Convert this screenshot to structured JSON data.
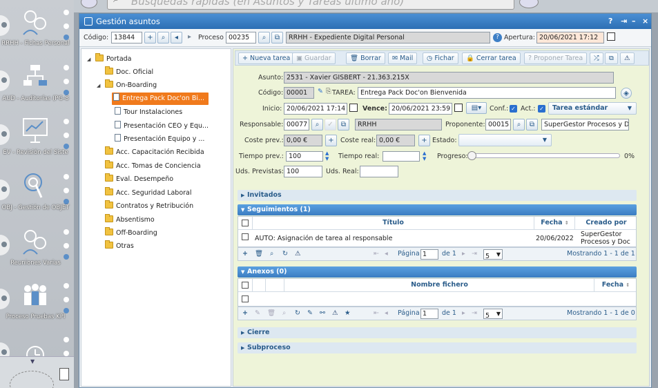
{
  "topbar": {
    "search_placeholder": "Búsquedas rápidas (en Asuntos y Tareas último año)"
  },
  "launcher": {
    "items": [
      {
        "label": "RRHH - Fichas Personal"
      },
      {
        "label": "AUD - Auditorías (PG-8"
      },
      {
        "label": "EV - Revisión del Siste"
      },
      {
        "label": "OBJ - Gestión de OBJET"
      },
      {
        "label": "Reuniones Varias"
      },
      {
        "label": "Proceso Pruebas KPI"
      }
    ]
  },
  "window": {
    "title": "Gestión asuntos",
    "controls": [
      "?",
      "⇥",
      "–",
      "×"
    ]
  },
  "header": {
    "codigo_label": "Código:",
    "codigo_value": "13844",
    "proceso_label": "Proceso",
    "proceso_value": "00235",
    "proceso_name": "RRHH - Expediente Digital Personal",
    "apertura_label": "Apertura:",
    "apertura_value": "20/06/2021 17:12"
  },
  "tree": {
    "items": [
      {
        "label": "Portada",
        "type": "folder"
      },
      {
        "label": "Doc. Oficial",
        "type": "folder"
      },
      {
        "label": "On-Boarding",
        "type": "folder"
      },
      {
        "label": "Entrega Pack Doc'on Bi...",
        "type": "page",
        "selected": true
      },
      {
        "label": "Tour Instalaciones",
        "type": "page"
      },
      {
        "label": "Presentación CEO y Equ...",
        "type": "page"
      },
      {
        "label": "Presentación Equipo y ...",
        "type": "page"
      },
      {
        "label": "Acc. Capacitación Recibida",
        "type": "folder"
      },
      {
        "label": "Acc. Tomas de Conciencia",
        "type": "folder"
      },
      {
        "label": "Eval. Desempeño",
        "type": "folder"
      },
      {
        "label": "Acc. Seguridad Laboral",
        "type": "folder"
      },
      {
        "label": "Contratos y Retribución",
        "type": "folder"
      },
      {
        "label": "Absentismo",
        "type": "folder"
      },
      {
        "label": "Off-Boarding",
        "type": "folder"
      },
      {
        "label": "Otras",
        "type": "folder"
      }
    ]
  },
  "toolbar": {
    "nueva": "Nueva tarea",
    "guardar": "Guardar",
    "borrar": "Borrar",
    "mail": "Mail",
    "fichar": "Fichar",
    "cerrar": "Cerrar tarea",
    "proponer": "Proponer Tarea"
  },
  "form": {
    "asunto_label": "Asunto:",
    "asunto_value": "2531 - Xavier GISBERT  - 21.363.215X",
    "codigo_label": "Código:",
    "codigo_value": "00001",
    "tarea_label": "TAREA:",
    "tarea_value": "Entrega Pack Doc'on Bienvenida",
    "inicio_label": "Inicio:",
    "inicio_value": "20/06/2021 17:14",
    "vence_label": "Vence:",
    "vence_value": "20/06/2021 23:59",
    "conf_label": "Conf.:",
    "act_label": "Act.:",
    "tipo_value": "Tarea estándar",
    "responsable_label": "Responsable:",
    "responsable_code": "00077",
    "responsable_name": "RRHH",
    "proponente_label": "Proponente:",
    "proponente_code": "00015",
    "proponente_name": "SuperGestor Procesos y Doc",
    "coste_prev_label": "Coste prev.:",
    "coste_prev_value": "0,00 €",
    "coste_real_label": "Coste real:",
    "coste_real_value": "0,00 €",
    "estado_label": "Estado:",
    "estado_value": "",
    "tiempo_prev_label": "Tiempo prev.:",
    "tiempo_prev_value": "100",
    "tiempo_real_label": "Tiempo real:",
    "tiempo_real_value": "",
    "progreso_label": "Progreso:",
    "progreso_value": "0%",
    "progreso_fraction": 0,
    "uds_prev_label": "Uds. Previstas:",
    "uds_prev_value": "100",
    "uds_real_label": "Uds. Real:",
    "uds_real_value": ""
  },
  "sections": {
    "invitados": "Invitados",
    "seguimientos": "Seguimientos (1)",
    "anexos": "Anexos (0)",
    "cierre": "Cierre",
    "subproceso": "Subproceso"
  },
  "seguimientos": {
    "columns": [
      "Título",
      "Fecha",
      "Creado por"
    ],
    "rows": [
      {
        "titulo": "AUTO: Asignación de tarea al responsable",
        "fecha": "20/06/2022",
        "creado_1": "SuperGestor",
        "creado_2": "Procesos y Doc"
      }
    ],
    "pager": {
      "pagina_label": "Página",
      "page": "1",
      "de_label": "de 1",
      "per_page": "5",
      "summary": "Mostrando 1 - 1 de 1"
    }
  },
  "anexos": {
    "columns": [
      "Nombre fichero",
      "Fecha"
    ],
    "pager": {
      "pagina_label": "Página",
      "page": "1",
      "de_label": "de 1",
      "per_page": "5",
      "summary": "Mostrando 1 - 1 de 0"
    }
  }
}
